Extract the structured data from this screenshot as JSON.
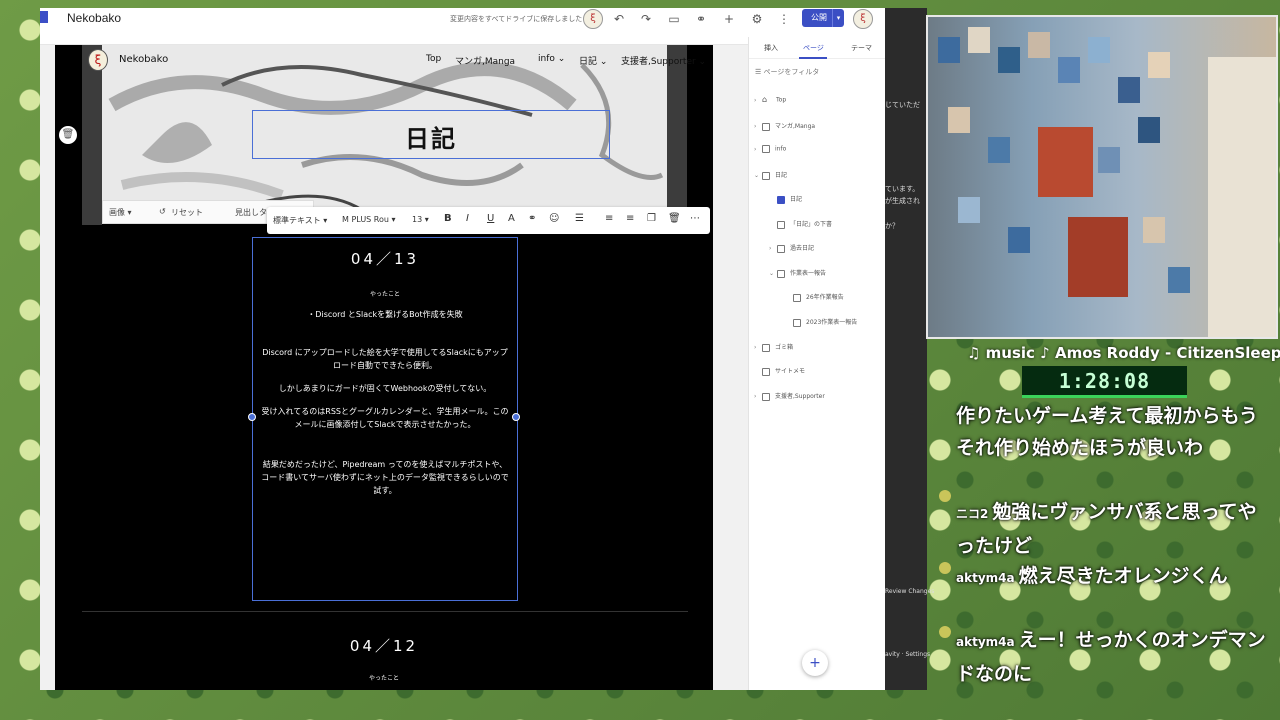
{
  "editor": {
    "site_title": "Nekobako",
    "save_status": "変更内容をすべてドライブに保存しました",
    "publish_label": "公開",
    "avatar_glyph": "ξ",
    "toolbar_icons": [
      "undo-icon",
      "redo-icon",
      "preview-icon",
      "link-icon",
      "add-person-icon",
      "gear-icon",
      "more-icon"
    ]
  },
  "site": {
    "logo_glyph": "ξ",
    "name": "Nekobako",
    "nav": [
      "Top",
      "マンガ,Manga",
      "info ⌄",
      "日記 ⌄",
      "支援者,Supporter ⌄"
    ],
    "hero_title": "日記"
  },
  "image_toolbar": {
    "image_label": "画像 ▾",
    "reset_label": "リセット",
    "fit_label": "見出しタイプ"
  },
  "text_toolbar": {
    "style": "標準テキスト ▾",
    "font": "M PLUS Rou ▾",
    "size": "13 ▾",
    "bold": "B",
    "italic": "I",
    "underline": "U",
    "color": "A"
  },
  "post1": {
    "date": "04／13",
    "section": "やったこと",
    "bullet": "・Discord とSlackを繋げるBot作成を失敗",
    "p1": "Discord にアップロードした絵を大学で使用してるSlackにもアップロード自動でできたら便利。",
    "p2": "しかしあまりにガードが固くてWebhookの受付してない。",
    "p3": "受け入れてるのはRSSとグーグルカレンダーと、学生用メール。このメールに画像添付してSlackで表示させたかった。",
    "p4": "結果だめだったけど、Pipedream ってのを使えばマルチポストや、コード書いてサーバ使わずにネット上のデータ監視できるらしいので試す。"
  },
  "post2": {
    "date": "04／12",
    "section": "やったこと"
  },
  "panel": {
    "tabs": [
      "挿入",
      "ページ",
      "テーマ"
    ],
    "filter": "ページをフィルタ",
    "pages": [
      {
        "label": "Top",
        "level": 0,
        "expand": "›",
        "icon": "home"
      },
      {
        "label": "マンガ,Manga",
        "level": 0,
        "expand": "›",
        "icon": "page"
      },
      {
        "label": "info",
        "level": 0,
        "expand": "›",
        "icon": "page"
      },
      {
        "label": "日記",
        "level": 0,
        "expand": "⌄",
        "icon": "page"
      },
      {
        "label": "日記",
        "level": 1,
        "expand": "",
        "icon": "blue"
      },
      {
        "label": "「日記」の下書",
        "level": 1,
        "expand": "",
        "icon": "hidden"
      },
      {
        "label": "過去日記",
        "level": 1,
        "expand": "›",
        "icon": "page"
      },
      {
        "label": "作業表一報告",
        "level": 1,
        "expand": "⌄",
        "icon": "page"
      },
      {
        "label": "26年作業報告",
        "level": 2,
        "expand": "",
        "icon": "page"
      },
      {
        "label": "2023作業表一報告",
        "level": 2,
        "expand": "",
        "icon": "page"
      },
      {
        "label": "ゴミ箱",
        "level": 0,
        "expand": "›",
        "icon": "hidden"
      },
      {
        "label": "サイトメモ",
        "level": 0,
        "expand": "",
        "icon": "hidden"
      },
      {
        "label": "支援者,Supporter",
        "level": 0,
        "expand": "›",
        "icon": "page"
      }
    ]
  },
  "sliver": {
    "t1": "じていただ",
    "t2": "ています。",
    "t3": "が生成され",
    "t4": "か？",
    "t5": "Review Changes",
    "t6": "avity · Settings"
  },
  "stream": {
    "music": "♫ music ♪ Amos Roddy - CitizenSleeper:",
    "timer": "1:28:08",
    "chat": [
      {
        "user": "",
        "text": "作りたいゲーム考えて最初からもうそれ作り始めたほうが良いわ"
      },
      {
        "user": "ニコ2",
        "text": "勉強にヴァンサバ系と思ってやったけど"
      },
      {
        "user": "aktym4a",
        "text": "燃え尽きたオレンジくん"
      },
      {
        "user": "aktym4a",
        "text": "えー！せっかくのオンデマンドなのに"
      }
    ]
  }
}
